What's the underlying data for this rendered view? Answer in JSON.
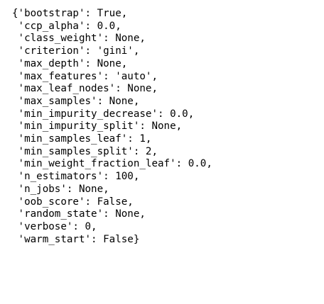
{
  "output": {
    "lines": [
      "{'bootstrap': True,",
      " 'ccp_alpha': 0.0,",
      " 'class_weight': None,",
      " 'criterion': 'gini',",
      " 'max_depth': None,",
      " 'max_features': 'auto',",
      " 'max_leaf_nodes': None,",
      " 'max_samples': None,",
      " 'min_impurity_decrease': 0.0,",
      " 'min_impurity_split': None,",
      " 'min_samples_leaf': 1,",
      " 'min_samples_split': 2,",
      " 'min_weight_fraction_leaf': 0.0,",
      " 'n_estimators': 100,",
      " 'n_jobs': None,",
      " 'oob_score': False,",
      " 'random_state': None,",
      " 'verbose': 0,",
      " 'warm_start': False}"
    ]
  }
}
